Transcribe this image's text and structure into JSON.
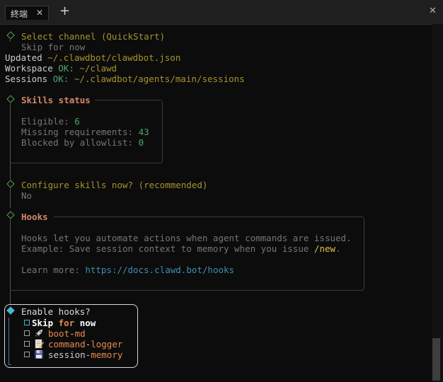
{
  "tab": {
    "title": "終端",
    "close": "✕"
  },
  "new_tab": "+",
  "window_close": "✕",
  "select_channel": {
    "label": "Select channel (QuickStart)",
    "value": "Skip for now"
  },
  "updated": {
    "label": "Updated",
    "path": "~/.clawdbot/clawdbot.json"
  },
  "workspace": {
    "label": "Workspace",
    "status": "OK:",
    "path": "~/clawd"
  },
  "sessions": {
    "label": "Sessions",
    "status": "OK:",
    "path": "~/.clawdbot/agents/main/sessions"
  },
  "skills": {
    "title": "Skills status",
    "eligible_label": "Eligible:",
    "eligible": "6",
    "missing_label": "Missing requirements:",
    "missing": "43",
    "blocked_label": "Blocked by allowlist:",
    "blocked": "0"
  },
  "configure": {
    "label": "Configure skills now? (recommended)",
    "value": "No"
  },
  "hooks": {
    "title": "Hooks",
    "line1": "Hooks let you automate actions when agent commands are issued.",
    "line2_prefix": "Example: Save session context to memory when you issue",
    "line2_cmd": "/new",
    "line2_suffix": ".",
    "learn_label": "Learn more:",
    "learn_url": "https://docs.clawd.bot/hooks"
  },
  "prompt": {
    "question": "Enable hooks?",
    "options": [
      {
        "pre": "Skip",
        "mid": "for",
        "post": "now"
      },
      {
        "pre": "boot",
        "sep": "-",
        "post": "md",
        "icon": "rocket-icon"
      },
      {
        "pre": "command",
        "sep": "-",
        "post": "logger",
        "icon": "memo-icon"
      },
      {
        "pre": "session",
        "sep": "-",
        "post": "memory",
        "icon": "floppy-disk-icon"
      }
    ]
  },
  "colors": {
    "background": "#0c0c0c",
    "heading": "#a5932e",
    "accent_ok": "#4aa86a",
    "section_title": "#d4876a",
    "link": "#3d8fb0",
    "selected": "#45b8d8"
  }
}
